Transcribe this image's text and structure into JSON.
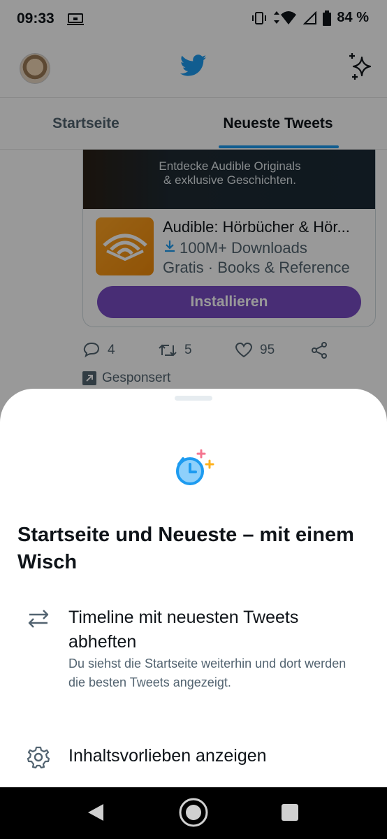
{
  "status_bar": {
    "time": "09:33",
    "battery": "84 %"
  },
  "header": {
    "avatar_icon": "user-avatar",
    "logo_icon": "twitter-bird-icon",
    "sparkle_icon": "sparkle-icon"
  },
  "tabs": [
    {
      "label": "Startseite"
    },
    {
      "label": "Neueste Tweets"
    }
  ],
  "ad": {
    "banner_line1": "Entdecke Audible Originals",
    "banner_line2": "& exklusive Geschichten.",
    "app_name": "Audible: Hörbücher & Hör...",
    "downloads": "100M+ Downloads",
    "meta": "Gratis · Books & Reference",
    "install_label": "Installieren"
  },
  "actions": {
    "replies": "4",
    "retweets": "5",
    "likes": "95"
  },
  "sponsored_label": "Gesponsert",
  "sheet": {
    "title": "Startseite und Neueste – mit einem Wisch",
    "option1_title": "Timeline mit neuesten Tweets abheften",
    "option1_desc": "Du siehst die Startseite weiterhin und dort werden die besten Tweets angezeigt.",
    "option2_title": "Inhaltsvorlieben anzeigen"
  },
  "colors": {
    "accent": "#1d9bf0",
    "install_button": "#794bc4",
    "text_primary": "#0f1419",
    "text_secondary": "#536471"
  }
}
